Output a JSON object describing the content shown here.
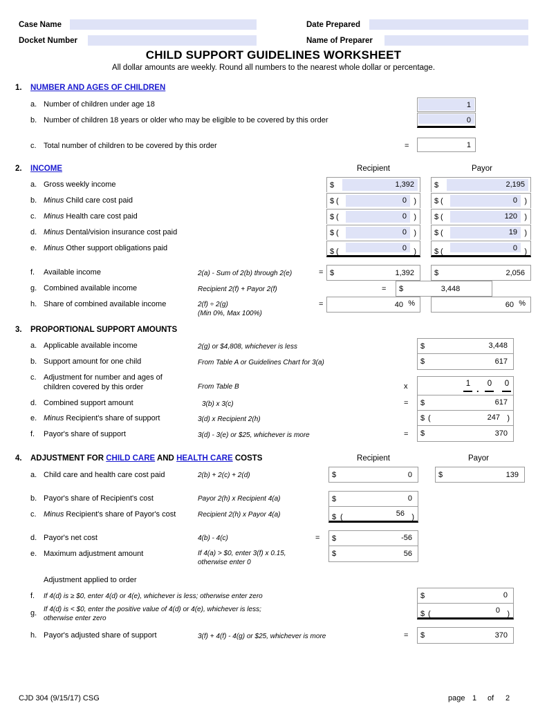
{
  "header": {
    "case_name_label": "Case Name",
    "case_name_value": "",
    "docket_label": "Docket Number",
    "docket_value": "",
    "date_prepared_label": "Date Prepared",
    "date_prepared_value": "",
    "preparer_label": "Name of Preparer",
    "preparer_value": ""
  },
  "title": "CHILD SUPPORT GUIDELINES WORKSHEET",
  "subtitle": "All dollar amounts are weekly.  Round all numbers to the nearest whole dollar or percentage.",
  "columns": {
    "recipient": "Recipient",
    "payor": "Payor"
  },
  "symbols": {
    "equals": "=",
    "times": "x",
    "percent": "%",
    "dollar": "$",
    "paren_open": "(",
    "paren_close": ")"
  },
  "colors": {
    "field_shade": "#dfe3f7",
    "link": "#1a1ad0",
    "box_border": "#9a9a9a"
  },
  "section1": {
    "number": "1.",
    "title": "NUMBER AND AGES OF CHILDREN",
    "a": {
      "letter": "a.",
      "text": "Number of children under age 18",
      "value": "1"
    },
    "b": {
      "letter": "b.",
      "text": "Number of children 18 years or older who may be eligible to be covered by this order",
      "value": "0"
    },
    "c": {
      "letter": "c.",
      "text": "Total number of children to be covered by this order",
      "value": "1"
    }
  },
  "section2": {
    "number": "2.",
    "title": "INCOME",
    "a": {
      "letter": "a.",
      "text": "Gross weekly income",
      "recipient": "1,392",
      "payor": "2,195"
    },
    "b": {
      "letter": "b.",
      "minus": "Minus",
      "text": "Child care cost paid",
      "recipient": "0",
      "payor": "0"
    },
    "c": {
      "letter": "c.",
      "minus": "Minus",
      "text": "Health care cost paid",
      "recipient": "0",
      "payor": "120"
    },
    "d": {
      "letter": "d.",
      "minus": "Minus",
      "text": "Dental/vision insurance cost paid",
      "recipient": "0",
      "payor": "19"
    },
    "e": {
      "letter": "e.",
      "minus": "Minus",
      "text": "Other support obligations paid",
      "recipient": "0",
      "payor": "0"
    },
    "f": {
      "letter": "f.",
      "text": "Available income",
      "formula": "2(a) - Sum of 2(b) through 2(e)",
      "recipient": "1,392",
      "payor": "2,056"
    },
    "g": {
      "letter": "g.",
      "text": "Combined available income",
      "formula": "Recipient 2(f) + Payor 2(f)",
      "value": "3,448"
    },
    "h": {
      "letter": "h.",
      "text": "Share of combined available income",
      "formula": "2(f) ÷ 2(g)",
      "formula2": "(Min 0%, Max 100%)",
      "recipient": "40",
      "payor": "60"
    }
  },
  "section3": {
    "number": "3.",
    "title": "PROPORTIONAL SUPPORT AMOUNTS",
    "a": {
      "letter": "a.",
      "text": "Applicable available income",
      "formula": "2(g) or $4,808, whichever is less",
      "value": "3,448"
    },
    "b": {
      "letter": "b.",
      "text": "Support amount for one child",
      "formula": "From Table A or Guidelines Chart for 3(a)",
      "value": "617"
    },
    "c": {
      "letter": "c.",
      "text_line1": "Adjustment for number and ages of",
      "text_line2": "children covered by this order",
      "formula": "From Table B",
      "digit1": "1",
      "digit2": "0",
      "digit3": "0"
    },
    "d": {
      "letter": "d.",
      "text": "Combined support amount",
      "formula": "3(b) x 3(c)",
      "value": "617"
    },
    "e": {
      "letter": "e.",
      "minus": "Minus",
      "text": "Recipient's share of support",
      "formula": "3(d) x Recipient 2(h)",
      "value": "247"
    },
    "f": {
      "letter": "f.",
      "text": "Payor's share of support",
      "formula": "3(d) - 3(e) or $25, whichever is more",
      "value": "370"
    }
  },
  "section4": {
    "number": "4.",
    "title_part1": "ADJUSTMENT FOR ",
    "title_link1": "CHILD CARE",
    "title_part2": " AND ",
    "title_link2": "HEALTH CARE",
    "title_part3": " COSTS",
    "a": {
      "letter": "a.",
      "text": "Child care and health care cost paid",
      "formula": "2(b) + 2(c) + 2(d)",
      "recipient": "0",
      "payor": "139"
    },
    "b": {
      "letter": "b.",
      "text": "Payor's share of Recipient's cost",
      "formula": "Payor 2(h) x Recipient 4(a)",
      "value": "0"
    },
    "c": {
      "letter": "c.",
      "minus": "Minus",
      "text": "Recipient's share of Payor's cost",
      "formula": "Recipient 2(h) x Payor 4(a)",
      "value": "56"
    },
    "d": {
      "letter": "d.",
      "text": "Payor's net cost",
      "formula": "4(b) - 4(c)",
      "value": "-56"
    },
    "e": {
      "letter": "e.",
      "text": "Maximum adjustment amount",
      "formula": "If 4(a) > $0, enter 3(f) x 0.15,",
      "formula2": "otherwise enter 0",
      "value": "56"
    },
    "adjustment_label": "Adjustment applied to order",
    "f": {
      "letter": "f.",
      "text": "If 4(d) is ≥ $0, enter 4(d) or 4(e), whichever is less; otherwise enter zero",
      "value": "0"
    },
    "g": {
      "letter": "g.",
      "text_line1": "If 4(d) is < $0, enter the positive value of 4(d) or 4(e), whichever is less;",
      "text_line2": "otherwise enter zero",
      "value": "0"
    },
    "h": {
      "letter": "h.",
      "text": "Payor's adjusted share of support",
      "formula": "3(f) + 4(f) - 4(g) or $25, whichever is more",
      "value": "370"
    }
  },
  "footer": {
    "form_id": "CJD 304 (9/15/17)   CSG",
    "page_label": "page",
    "page_number": "1",
    "of_label": "of",
    "page_total": "2"
  }
}
